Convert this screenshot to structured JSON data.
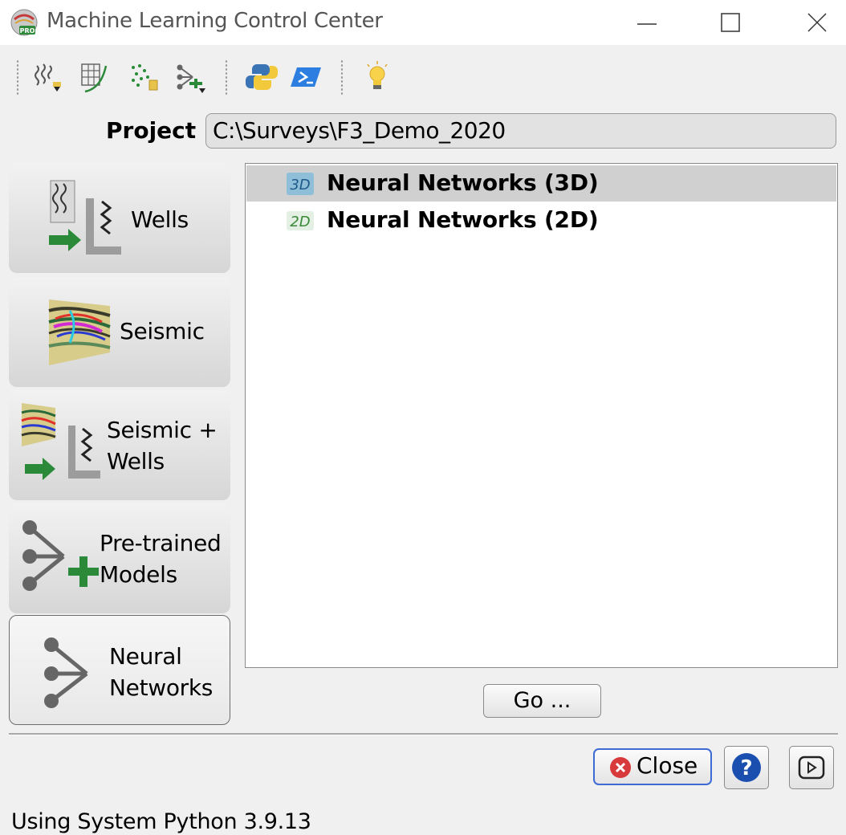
{
  "window": {
    "title": "Machine Learning Control Center",
    "controls": [
      "minimize",
      "maximize",
      "close"
    ]
  },
  "toolbar": {
    "icons": [
      "well-log-import-icon",
      "crossplot-icon",
      "point-data-import-icon",
      "model-import-icon",
      "python-icon",
      "powershell-icon",
      "lightbulb-icon"
    ]
  },
  "project": {
    "label": "Project",
    "path": "C:\\Surveys\\F3_Demo_2020"
  },
  "categories": [
    {
      "line1": "Wells",
      "line2": "",
      "icon": "wells-icon"
    },
    {
      "line1": "Seismic",
      "line2": "",
      "icon": "seismic-icon"
    },
    {
      "line1": "Seismic +",
      "line2": "Wells",
      "icon": "seismic-wells-icon"
    },
    {
      "line1": "Pre-trained",
      "line2": "Models",
      "icon": "pretrained-models-icon"
    },
    {
      "line1": "Neural",
      "line2": "Networks",
      "icon": "neural-network-icon",
      "active": true
    }
  ],
  "list": {
    "items": [
      {
        "badge": "3D",
        "label": "Neural Networks (3D)",
        "selected": true
      },
      {
        "badge": "2D",
        "label": "Neural Networks (2D)",
        "selected": false
      }
    ]
  },
  "actions": {
    "go": "Go ...",
    "close": "Close"
  },
  "status": "Using System Python 3.9.13"
}
